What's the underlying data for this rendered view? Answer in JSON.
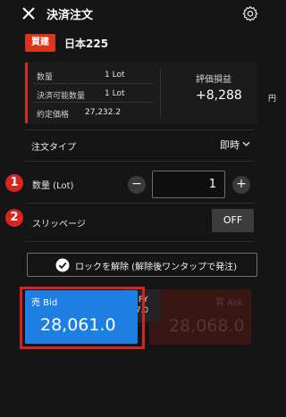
{
  "header": {
    "title": "決済注文",
    "close_icon": "close-icon",
    "settings_icon": "gear-icon"
  },
  "position": {
    "badge": "買建",
    "badge_color": "#d9361c",
    "instrument": "日本225"
  },
  "summary": {
    "quantity_label": "数量",
    "quantity_value": "1 Lot",
    "closable_label": "決済可能数量",
    "closable_value": "1 Lot",
    "contract_price_label": "約定価格",
    "contract_price_value": "27,232.2",
    "pnl_label": "評価損益",
    "pnl_value": "+8,288",
    "pnl_unit": "円"
  },
  "order_type": {
    "label": "注文タイプ",
    "value": "即時"
  },
  "quantity": {
    "marker": "1",
    "label": "数量 (Lot)",
    "minus": "−",
    "value": "1",
    "plus": "+"
  },
  "slippage": {
    "marker": "2",
    "label": "スリッページ",
    "toggle": "OFF"
  },
  "unlock": {
    "label": "ロックを解除 (解除後ワンタップで発注)"
  },
  "trade": {
    "sell_label": "売 Bid",
    "sell_price": "28,061.0",
    "sell_color": "#1e7fe2",
    "spread_line1": "JPY",
    "spread_line2": "7.0",
    "buy_label": "買 Ask",
    "buy_price": "28,068.0"
  }
}
